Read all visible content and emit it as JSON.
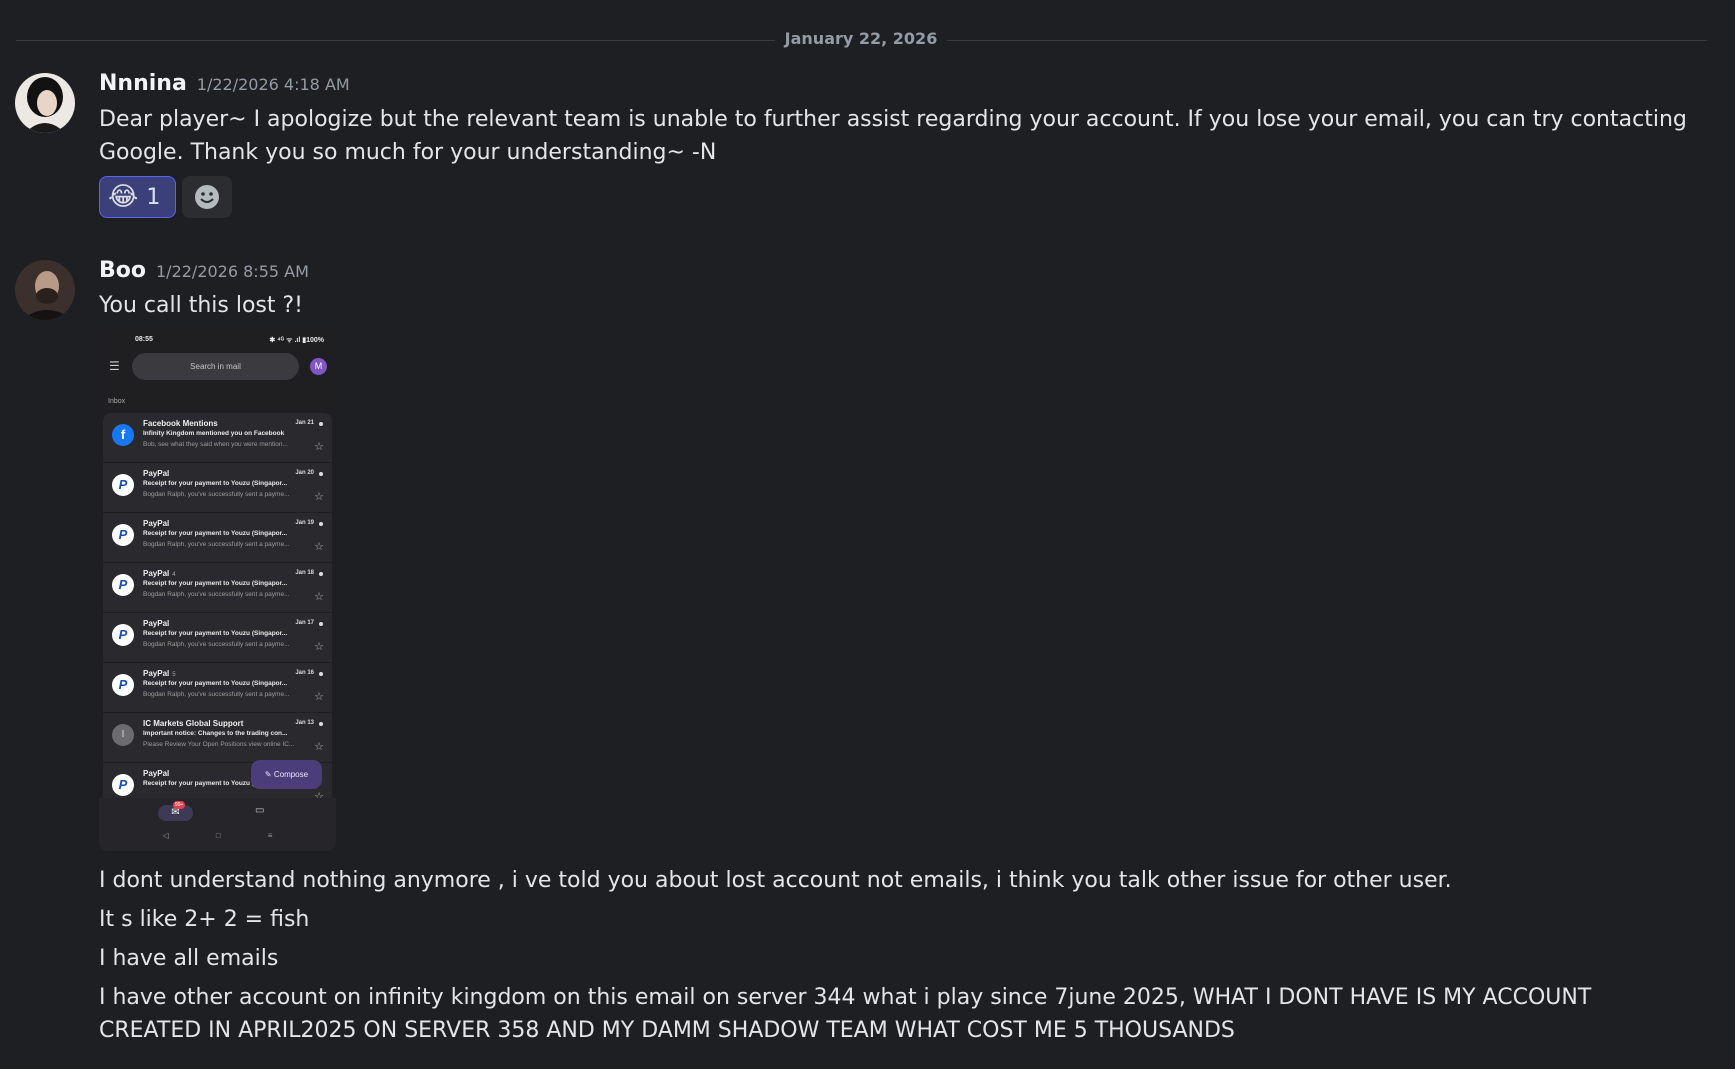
{
  "date_divider": "January 22, 2026",
  "messages": [
    {
      "author": "Nnnina",
      "timestamp": "1/22/2026 4:18 AM",
      "text": "Dear player~ I apologize but the relevant team is unable to further assist regarding your account. If you lose your email, you can try contacting Google. Thank you so much for your understanding~ -N",
      "reactions": [
        {
          "emoji": "😂",
          "count": "1"
        }
      ],
      "add_reaction_icon": "smiley-add-reaction-icon"
    },
    {
      "author": "Boo",
      "timestamp": "1/22/2026 8:55 AM",
      "text": "You call this lost ?!",
      "attachment": {
        "status_time": "08:55",
        "status_icons": "✱ ⁴ᴳ ᯤ .ıl ▮100%",
        "search_placeholder": "Search in mail",
        "avatar_letter": "M",
        "inbox_label": "Inbox",
        "emails": [
          {
            "icon": "f",
            "type": "fb",
            "sender": "Facebook Mentions",
            "count": "",
            "date": "Jan 21",
            "subject": "Infinity Kingdom mentioned you on Facebook",
            "snippet": "Bob, see what they said when you were mention..."
          },
          {
            "icon": "P",
            "type": "pp",
            "sender": "PayPal",
            "count": "",
            "date": "Jan 20",
            "subject": "Receipt for your payment to Youzu (Singapor...",
            "snippet": "Bogdan Ralph, you've successfully sent a payme..."
          },
          {
            "icon": "P",
            "type": "pp",
            "sender": "PayPal",
            "count": "",
            "date": "Jan 19",
            "subject": "Receipt for your payment to Youzu (Singapor...",
            "snippet": "Bogdan Ralph, you've successfully sent a payme..."
          },
          {
            "icon": "P",
            "type": "pp",
            "sender": "PayPal",
            "count": "4",
            "date": "Jan 18",
            "subject": "Receipt for your payment to Youzu (Singapor...",
            "snippet": "Bogdan Ralph, you've successfully sent a payme..."
          },
          {
            "icon": "P",
            "type": "pp",
            "sender": "PayPal",
            "count": "",
            "date": "Jan 17",
            "subject": "Receipt for your payment to Youzu (Singapor...",
            "snippet": "Bogdan Ralph, you've successfully sent a payme..."
          },
          {
            "icon": "P",
            "type": "pp",
            "sender": "PayPal",
            "count": "5",
            "date": "Jan 16",
            "subject": "Receipt for your payment to Youzu (Singapor...",
            "snippet": "Bogdan Ralph, you've successfully sent a payme..."
          },
          {
            "icon": "I",
            "type": "ic",
            "sender": "IC Markets Global Support",
            "count": "",
            "date": "Jan 13",
            "subject": "Important notice: Changes to the trading con...",
            "snippet": "Please Review Your Open Positions view online IC..."
          },
          {
            "icon": "P",
            "type": "pp",
            "sender": "PayPal",
            "count": "",
            "date": "",
            "subject": "Receipt for your payment to Youzu (Singapor...",
            "snippet": ""
          }
        ],
        "compose_label": "Compose",
        "mail_badge": "99+",
        "nav_back": "◁",
        "nav_home": "□",
        "nav_recent": "≡"
      },
      "followups": [
        "I dont understand nothing anymore , i ve told you about lost account not emails, i think you talk other issue for other user.",
        "It s like 2+ 2 = fish",
        "I have all emails",
        "I have other account on infinity kingdom on this email on server 344 what i play since 7june 2025, WHAT I DONT HAVE IS MY ACCOUNT CREATED IN APRIL2025 ON SERVER 358 AND MY DAMM SHADOW TEAM WHAT COST ME 5 THOUSANDS"
      ]
    }
  ]
}
